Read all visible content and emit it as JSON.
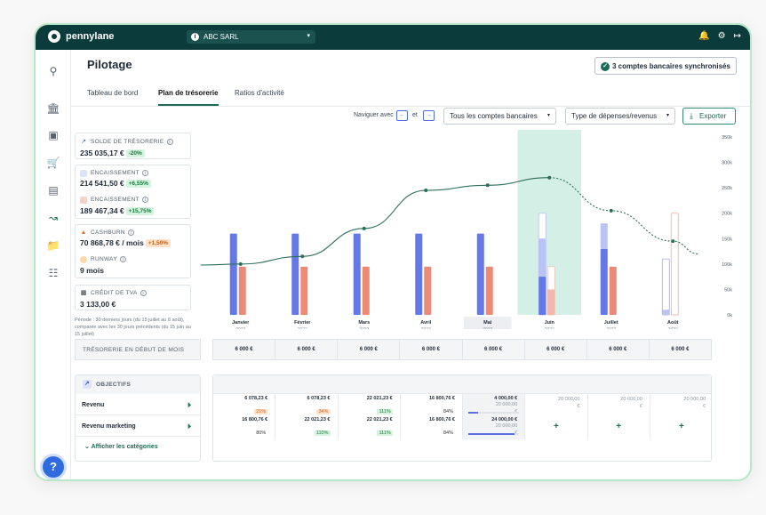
{
  "app": {
    "name": "pennylane",
    "company": "ABC SARL"
  },
  "page": {
    "title": "Pilotage",
    "bank_sync": "3 comptes bancaires synchronisés"
  },
  "tabs": [
    {
      "label": "Tableau de bord",
      "active": false
    },
    {
      "label": "Plan de trésorerie",
      "active": true
    },
    {
      "label": "Ratios d'activité",
      "active": false
    }
  ],
  "toolbar": {
    "navigate_label": "Naviguer avec",
    "navigate_and": "et",
    "accounts_select": "Tous les comptes bancaires",
    "type_select": "Type de dépenses/revenus",
    "export_label": "Exporter"
  },
  "kpis": {
    "solde": {
      "label": "SOLDE DE TRÉSORERIE",
      "value": "235 035,17 €",
      "badge": "-20%"
    },
    "enc1": {
      "label": "ENCAISSEMENT",
      "value": "214 541,50 €",
      "badge": "+6,55%"
    },
    "enc2": {
      "label": "ENCAISSEMENT",
      "value": "189 467,34 €",
      "badge": "+15,75%"
    },
    "cashburn": {
      "label": "CASHBURN",
      "value": "70 868,78 € / mois",
      "badge": "+1,50%"
    },
    "runway": {
      "label": "RUNWAY",
      "value": "9 mois"
    },
    "tva": {
      "label": "CRÉDIT DE TVA",
      "value": "3 133,00 €"
    }
  },
  "period_note": "Période : 30 derniers jours (du 15 juillet au 8 août), comparée avec les 30 jours précédents (du 15 juin au 15 juillet)",
  "chart_data": {
    "type": "bar",
    "categories": [
      "Janvier",
      "Février",
      "Mars",
      "Avril",
      "Mai",
      "Juin",
      "Juillet",
      "Août"
    ],
    "category_years": [
      "2022",
      "2022",
      "2022",
      "2022",
      "2022",
      "2022",
      "2022",
      "2022"
    ],
    "y_ticks": [
      "350k",
      "300k",
      "250k",
      "200k",
      "150k",
      "100k",
      "50k",
      "0k"
    ],
    "ylim": [
      0,
      350000
    ],
    "series": [
      {
        "values": [
          160000,
          160000,
          160000,
          160000,
          160000,
          150000,
          130000,
          10000
        ]
      },
      {
        "values": [
          95000,
          95000,
          95000,
          95000,
          95000,
          50000,
          95000,
          0
        ]
      },
      {
        "values": [
          100000,
          115000,
          170000,
          245000,
          255000,
          270000,
          205000,
          145000
        ]
      }
    ],
    "projected": {
      "series_0": [
        null,
        null,
        null,
        null,
        null,
        200000,
        180000,
        110000
      ],
      "series_1": [
        null,
        null,
        null,
        null,
        null,
        95000,
        null,
        200000
      ]
    },
    "highlight_category": "Juin",
    "colors": {
      "bar_blue": "#6478e8",
      "bar_salmon": "#ec8a78",
      "line": "#2c6e5c",
      "highlight": "#d4efe5"
    }
  },
  "treasury_row": {
    "label": "TRÉSORERIE EN DÉBUT DE MOIS",
    "values": [
      "6 000 €",
      "6 000 €",
      "6 000 €",
      "6 000 €",
      "6 000 €",
      "6 000 €",
      "6 000 €",
      "6 000 €"
    ]
  },
  "objectives": {
    "title": "OBJECTIFS",
    "rows": [
      {
        "label": "Revenu"
      },
      {
        "label": "Revenu marketing"
      }
    ],
    "show_categories": "Afficher les catégories"
  },
  "grid": {
    "revenu": [
      {
        "amount": "6 078,23 €",
        "pct": "21%",
        "style": "orange"
      },
      {
        "amount": "6 078,23 €",
        "pct": "34%",
        "style": "orange"
      },
      {
        "amount": "22 021,23 €",
        "pct": "111%",
        "style": "green"
      },
      {
        "amount": "16 800,76 €",
        "pct": "84%",
        "style": "plain"
      },
      {
        "amount": "4 000,00 €",
        "target": "20 000,00",
        "unit": "€",
        "progress": 0.2
      },
      {
        "target": "20 000,00",
        "unit": "€"
      },
      {
        "target": "20 000,00",
        "unit": "€"
      },
      {
        "target": "20 000,00",
        "unit": "€"
      }
    ],
    "marketing": [
      {
        "amount": "16 800,76 €",
        "pct": "80%",
        "style": "plain"
      },
      {
        "amount": "22 021,23 €",
        "pct": "110%",
        "style": "green"
      },
      {
        "amount": "22 021,23 €",
        "pct": "111%",
        "style": "green"
      },
      {
        "amount": "16 800,76 €",
        "pct": "84%",
        "style": "plain"
      },
      {
        "amount": "24 000,00 €",
        "target": "20 000,00",
        "unit": "€",
        "progress": 0.9
      },
      {
        "plus": "+"
      },
      {
        "plus": "+"
      },
      {
        "plus": "+"
      }
    ]
  },
  "icons": [
    "search-icon",
    "bank-icon",
    "wallet-icon",
    "cart-icon",
    "store-icon",
    "chart-icon",
    "folder-icon",
    "documents-icon",
    "help-icon",
    "bell-icon",
    "gear-icon",
    "logout-icon"
  ]
}
